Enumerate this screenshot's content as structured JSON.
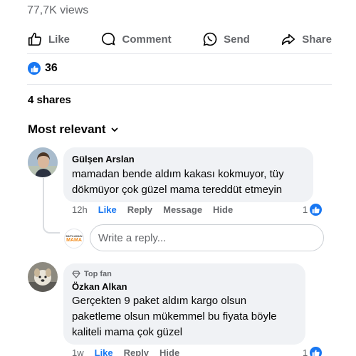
{
  "post": {
    "views": "77,7K views",
    "actions": {
      "like": "Like",
      "comment": "Comment",
      "send": "Send",
      "share": "Share"
    },
    "reactions_count": "36",
    "shares": "4 shares"
  },
  "comments_sort": "Most relevant",
  "comments": [
    {
      "author": "Gülşen Arslan",
      "text_line1": "mamadan bende aldım kakası kokmuyor, tüy",
      "text_line2": "dökmüyor çok güzel mama tereddüt etmeyin",
      "time": "12h",
      "like": "Like",
      "reply": "Reply",
      "message": "Message",
      "hide": "Hide",
      "reaction_count": "1"
    },
    {
      "badge": "Top fan",
      "author": "Özkan Alkan",
      "text_line1": "Gerçekten 9 paket aldım kargo olsun",
      "text_line2": "paketleme olsun mükemmel bu fiyata böyle",
      "text_line3": "kaliteli mama çok güzel",
      "time": "1w",
      "like": "Like",
      "reply": "Reply",
      "hide": "Hide",
      "reaction_count": "1"
    }
  ],
  "reply_box": {
    "placeholder": "Write a reply...",
    "page_avatar_text_top": "MUTLUMUN",
    "page_avatar_text_bottom": "MAMA"
  },
  "colors": {
    "accent": "#1877f2",
    "muted": "#65676b",
    "bubble": "#f0f2f5"
  }
}
